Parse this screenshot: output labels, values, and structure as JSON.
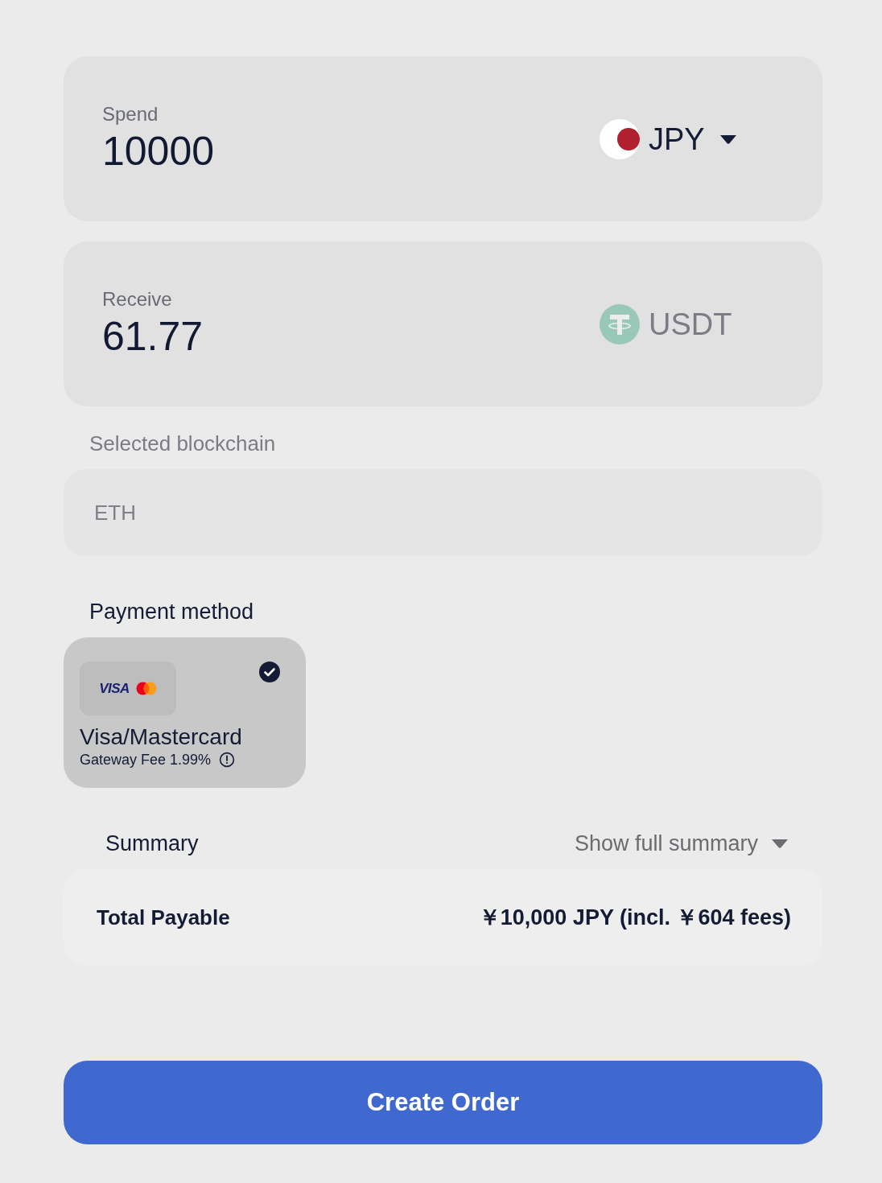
{
  "amounts": [
    {
      "label": "Spend",
      "value": "10000",
      "currency": {
        "code": "JPY",
        "kind": "flag",
        "disabled": false
      }
    },
    {
      "label": "Receive",
      "value": "61.77",
      "currency": {
        "code": "USDT",
        "kind": "coin",
        "disabled": true
      }
    }
  ],
  "blockchain": {
    "label": "Selected blockchain",
    "value": "ETH",
    "disabled": true
  },
  "payment": {
    "title": "Payment method",
    "methods": [
      {
        "logo_text": "VISA",
        "name": "Visa/Mastercard",
        "fee": "Gateway Fee 1.99%",
        "selected": true
      }
    ]
  },
  "summary": {
    "title": "Summary",
    "toggle": {
      "label": "Show full summary",
      "expanded": false
    },
    "total": {
      "label": "Total Payable",
      "value": "￥10,000 JPY (incl. ￥604 fees)"
    }
  },
  "primary_button": {
    "label": "Create Order"
  }
}
